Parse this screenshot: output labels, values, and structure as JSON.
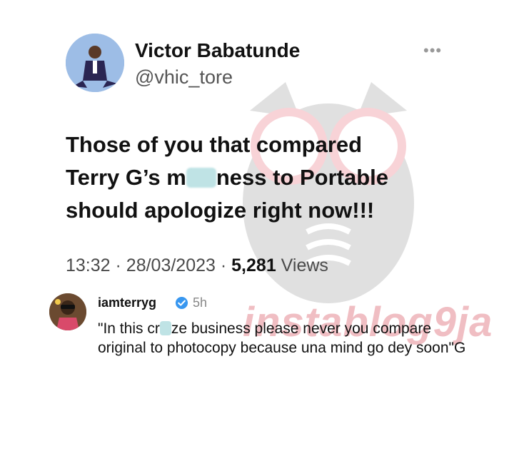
{
  "tweet": {
    "display_name": "Victor Babatunde",
    "handle": "@vhic_tore",
    "more_label": "•••",
    "text_line1": "Those of you that compared",
    "text_line2_a": "Terry G’s m",
    "text_line2_b": "ness to Portable",
    "text_line3": "should apologize right now!!!",
    "time": "13:32",
    "date": "28/03/2023",
    "separator": "·",
    "views_count": "5,281",
    "views_label": "Views"
  },
  "comment": {
    "username": "iamterryg",
    "time": "5h",
    "text_a": "\"In this cr",
    "text_b": "ze business please never you compare original to photocopy because una mind go dey soon\"G"
  },
  "watermark": {
    "text": "instablog9ja"
  }
}
